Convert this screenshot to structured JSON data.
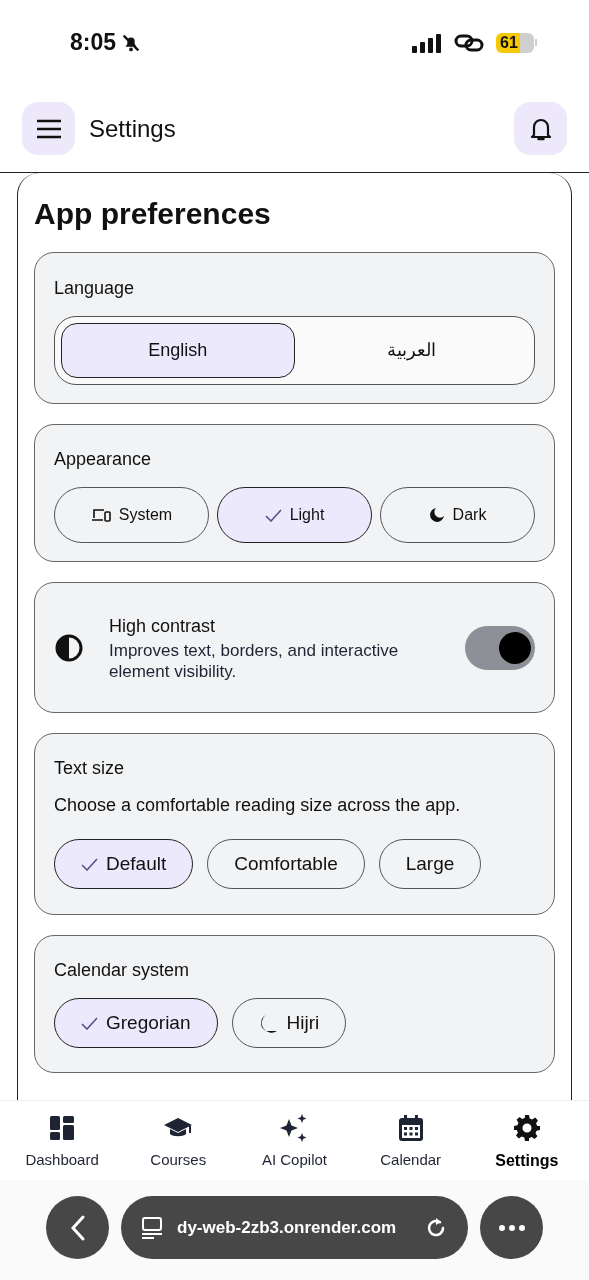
{
  "status_bar": {
    "time": "8:05",
    "battery": "61"
  },
  "header": {
    "title": "Settings"
  },
  "app_preferences": {
    "title": "App preferences",
    "language": {
      "label": "Language",
      "options": [
        {
          "label": "English",
          "selected": true
        },
        {
          "label": "العربية",
          "selected": false
        }
      ]
    },
    "appearance": {
      "label": "Appearance",
      "options": [
        {
          "label": "System",
          "selected": false
        },
        {
          "label": "Light",
          "selected": true
        },
        {
          "label": "Dark",
          "selected": false
        }
      ]
    },
    "high_contrast": {
      "title": "High contrast",
      "description": "Improves text, borders, and interactive element visibility.",
      "on": true
    },
    "text_size": {
      "label": "Text size",
      "description": "Choose a comfortable reading size across the app.",
      "options": [
        {
          "label": "Default",
          "selected": true
        },
        {
          "label": "Comfortable",
          "selected": false
        },
        {
          "label": "Large",
          "selected": false
        }
      ]
    },
    "calendar_system": {
      "label": "Calendar system",
      "options": [
        {
          "label": "Gregorian",
          "selected": true
        },
        {
          "label": "Hijri",
          "selected": false
        }
      ]
    }
  },
  "bottom_nav": [
    {
      "label": "Dashboard",
      "selected": false
    },
    {
      "label": "Courses",
      "selected": false
    },
    {
      "label": "AI Copilot",
      "selected": false
    },
    {
      "label": "Calendar",
      "selected": false
    },
    {
      "label": "Settings",
      "selected": true
    }
  ],
  "browser_bar": {
    "url": "dy-web-2zb3.onrender.com"
  }
}
